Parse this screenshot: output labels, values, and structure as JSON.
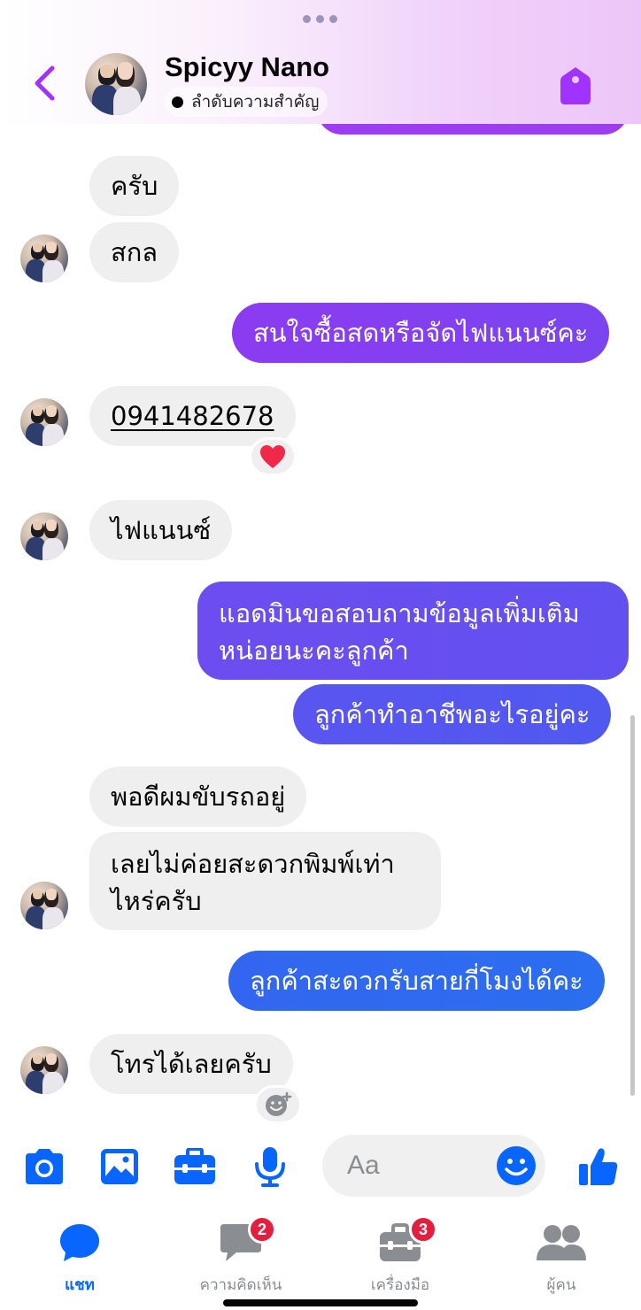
{
  "header": {
    "contact_name": "Spicyy Nano",
    "priority_label": "ลำดับความสำคัญ",
    "back_icon": "chevron-left-icon",
    "tag_icon": "tag-icon",
    "accent_color": "#a033ff"
  },
  "messages": {
    "m1": "ครับ",
    "m2": "สกล",
    "m3": "สนใจซื้อสดหรือจัดไฟแนนซ์คะ",
    "m4": "0941482678",
    "m4_reaction": "❤️",
    "m5": "ไฟแนนซ์",
    "m6_line1": "แอดมินขอสอบถามข้อมูลเพิ่มเติม",
    "m6_line2": "หน่อยนะคะลูกค้า",
    "m7": "ลูกค้าทำอาชีพอะไรอยู่คะ",
    "m8": "พอดีผมขับรถอยู่",
    "m9_line1": "เลยไม่ค่อยสะดวกพิมพ์เท่า",
    "m9_line2": "ไหร่ครับ",
    "m10": "ลูกค้าสะดวกรับสายกี่โมงได้คะ",
    "m11": "โทรได้เลยครับ"
  },
  "composer": {
    "placeholder": "Aa",
    "icons": [
      "camera-icon",
      "image-icon",
      "briefcase-icon",
      "microphone-icon",
      "emoji-icon",
      "thumbs-up-icon"
    ]
  },
  "nav": {
    "chat_label": "แชท",
    "comments_label": "ความคิดเห็น",
    "comments_badge": "2",
    "tools_label": "เครื่องมือ",
    "tools_badge": "3",
    "people_label": "ผู้คน"
  },
  "colors": {
    "incoming_bubble": "#efefef",
    "outgoing_purple": "#8c3cf0",
    "outgoing_blue": "#2b6ef0",
    "messenger_blue": "#0866ff",
    "badge_red": "#e41e3f"
  }
}
